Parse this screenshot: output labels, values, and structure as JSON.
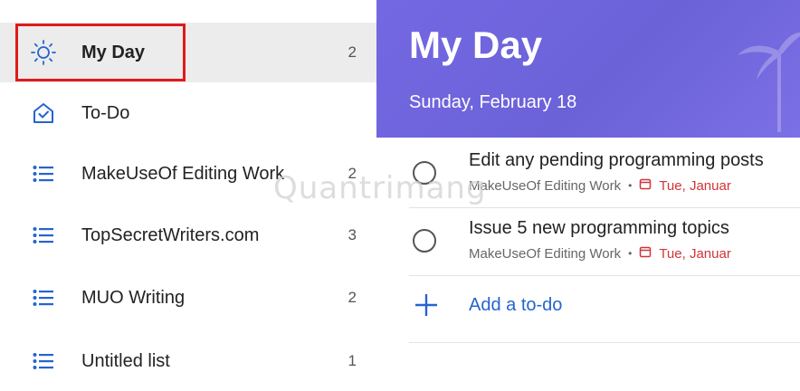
{
  "sidebar": {
    "items": [
      {
        "label": "My Day",
        "count": "2",
        "icon": "sun-icon"
      },
      {
        "label": "To-Do",
        "count": "",
        "icon": "home-icon"
      },
      {
        "label": "MakeUseOf Editing Work",
        "count": "2",
        "icon": "list-icon"
      },
      {
        "label": "TopSecretWriters.com",
        "count": "3",
        "icon": "list-icon"
      },
      {
        "label": "MUO Writing",
        "count": "2",
        "icon": "list-icon"
      },
      {
        "label": "Untitled list",
        "count": "1",
        "icon": "list-icon"
      }
    ]
  },
  "header": {
    "title": "My Day",
    "date": "Sunday, February 18"
  },
  "tasks": [
    {
      "title": "Edit any pending programming posts",
      "list": "MakeUseOf Editing Work",
      "due": "Tue, Januar"
    },
    {
      "title": "Issue 5 new programming topics",
      "list": "MakeUseOf Editing Work",
      "due": "Tue, Januar"
    }
  ],
  "add_todo": {
    "label": "Add a to-do"
  },
  "watermark": "Quantrimang",
  "colors": {
    "accent": "#2564cf",
    "header": "#6f66dc",
    "due": "#d13438",
    "highlight": "#e01a1a"
  }
}
